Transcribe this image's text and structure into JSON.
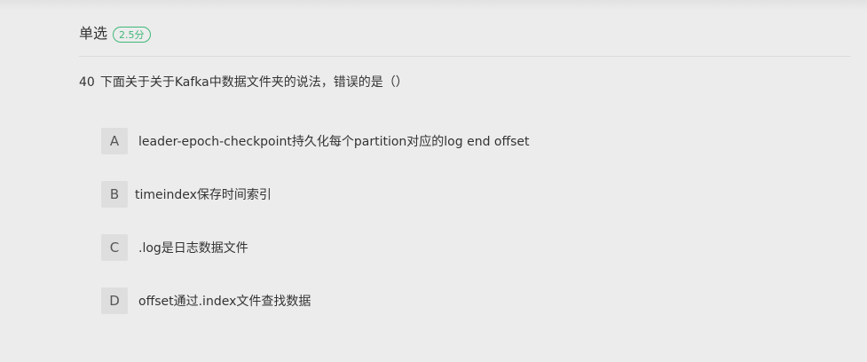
{
  "question": {
    "type_label": "单选",
    "score": "2.5分",
    "number": "40",
    "text": "下面关于关于Kafka中数据文件夹的说法，错误的是（）"
  },
  "options": [
    {
      "letter": "A",
      "text": "leader-epoch-checkpoint持久化每个partition对应的log end offset"
    },
    {
      "letter": "B",
      "text": "timeindex保存时间索引"
    },
    {
      "letter": "C",
      "text": ".log是日志数据文件"
    },
    {
      "letter": "D",
      "text": "offset通过.index文件查找数据"
    }
  ],
  "colors": {
    "background": "#ececec",
    "accent": "#3fb878"
  }
}
